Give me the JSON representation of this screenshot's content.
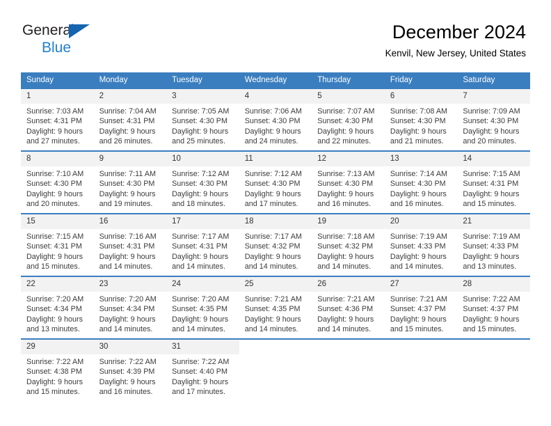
{
  "brand": {
    "line1": "General",
    "line2": "Blue",
    "triangle_color": "#1565b0",
    "line2_color": "#1f7fd4"
  },
  "header": {
    "title": "December 2024",
    "subtitle": "Kenvil, New Jersey, United States"
  },
  "theme": {
    "header_row_bg": "#3a7ebf",
    "header_row_text": "#ffffff",
    "daynum_bg": "#f2f2f2",
    "row_border": "#3a7ebf",
    "body_text": "#3b3b3b"
  },
  "weekday_headers": [
    "Sunday",
    "Monday",
    "Tuesday",
    "Wednesday",
    "Thursday",
    "Friday",
    "Saturday"
  ],
  "weeks": [
    [
      {
        "day": "1",
        "sunrise": "Sunrise: 7:03 AM",
        "sunset": "Sunset: 4:31 PM",
        "daylight1": "Daylight: 9 hours",
        "daylight2": "and 27 minutes."
      },
      {
        "day": "2",
        "sunrise": "Sunrise: 7:04 AM",
        "sunset": "Sunset: 4:31 PM",
        "daylight1": "Daylight: 9 hours",
        "daylight2": "and 26 minutes."
      },
      {
        "day": "3",
        "sunrise": "Sunrise: 7:05 AM",
        "sunset": "Sunset: 4:30 PM",
        "daylight1": "Daylight: 9 hours",
        "daylight2": "and 25 minutes."
      },
      {
        "day": "4",
        "sunrise": "Sunrise: 7:06 AM",
        "sunset": "Sunset: 4:30 PM",
        "daylight1": "Daylight: 9 hours",
        "daylight2": "and 24 minutes."
      },
      {
        "day": "5",
        "sunrise": "Sunrise: 7:07 AM",
        "sunset": "Sunset: 4:30 PM",
        "daylight1": "Daylight: 9 hours",
        "daylight2": "and 22 minutes."
      },
      {
        "day": "6",
        "sunrise": "Sunrise: 7:08 AM",
        "sunset": "Sunset: 4:30 PM",
        "daylight1": "Daylight: 9 hours",
        "daylight2": "and 21 minutes."
      },
      {
        "day": "7",
        "sunrise": "Sunrise: 7:09 AM",
        "sunset": "Sunset: 4:30 PM",
        "daylight1": "Daylight: 9 hours",
        "daylight2": "and 20 minutes."
      }
    ],
    [
      {
        "day": "8",
        "sunrise": "Sunrise: 7:10 AM",
        "sunset": "Sunset: 4:30 PM",
        "daylight1": "Daylight: 9 hours",
        "daylight2": "and 20 minutes."
      },
      {
        "day": "9",
        "sunrise": "Sunrise: 7:11 AM",
        "sunset": "Sunset: 4:30 PM",
        "daylight1": "Daylight: 9 hours",
        "daylight2": "and 19 minutes."
      },
      {
        "day": "10",
        "sunrise": "Sunrise: 7:12 AM",
        "sunset": "Sunset: 4:30 PM",
        "daylight1": "Daylight: 9 hours",
        "daylight2": "and 18 minutes."
      },
      {
        "day": "11",
        "sunrise": "Sunrise: 7:12 AM",
        "sunset": "Sunset: 4:30 PM",
        "daylight1": "Daylight: 9 hours",
        "daylight2": "and 17 minutes."
      },
      {
        "day": "12",
        "sunrise": "Sunrise: 7:13 AM",
        "sunset": "Sunset: 4:30 PM",
        "daylight1": "Daylight: 9 hours",
        "daylight2": "and 16 minutes."
      },
      {
        "day": "13",
        "sunrise": "Sunrise: 7:14 AM",
        "sunset": "Sunset: 4:30 PM",
        "daylight1": "Daylight: 9 hours",
        "daylight2": "and 16 minutes."
      },
      {
        "day": "14",
        "sunrise": "Sunrise: 7:15 AM",
        "sunset": "Sunset: 4:31 PM",
        "daylight1": "Daylight: 9 hours",
        "daylight2": "and 15 minutes."
      }
    ],
    [
      {
        "day": "15",
        "sunrise": "Sunrise: 7:15 AM",
        "sunset": "Sunset: 4:31 PM",
        "daylight1": "Daylight: 9 hours",
        "daylight2": "and 15 minutes."
      },
      {
        "day": "16",
        "sunrise": "Sunrise: 7:16 AM",
        "sunset": "Sunset: 4:31 PM",
        "daylight1": "Daylight: 9 hours",
        "daylight2": "and 14 minutes."
      },
      {
        "day": "17",
        "sunrise": "Sunrise: 7:17 AM",
        "sunset": "Sunset: 4:31 PM",
        "daylight1": "Daylight: 9 hours",
        "daylight2": "and 14 minutes."
      },
      {
        "day": "18",
        "sunrise": "Sunrise: 7:17 AM",
        "sunset": "Sunset: 4:32 PM",
        "daylight1": "Daylight: 9 hours",
        "daylight2": "and 14 minutes."
      },
      {
        "day": "19",
        "sunrise": "Sunrise: 7:18 AM",
        "sunset": "Sunset: 4:32 PM",
        "daylight1": "Daylight: 9 hours",
        "daylight2": "and 14 minutes."
      },
      {
        "day": "20",
        "sunrise": "Sunrise: 7:19 AM",
        "sunset": "Sunset: 4:33 PM",
        "daylight1": "Daylight: 9 hours",
        "daylight2": "and 14 minutes."
      },
      {
        "day": "21",
        "sunrise": "Sunrise: 7:19 AM",
        "sunset": "Sunset: 4:33 PM",
        "daylight1": "Daylight: 9 hours",
        "daylight2": "and 13 minutes."
      }
    ],
    [
      {
        "day": "22",
        "sunrise": "Sunrise: 7:20 AM",
        "sunset": "Sunset: 4:34 PM",
        "daylight1": "Daylight: 9 hours",
        "daylight2": "and 13 minutes."
      },
      {
        "day": "23",
        "sunrise": "Sunrise: 7:20 AM",
        "sunset": "Sunset: 4:34 PM",
        "daylight1": "Daylight: 9 hours",
        "daylight2": "and 14 minutes."
      },
      {
        "day": "24",
        "sunrise": "Sunrise: 7:20 AM",
        "sunset": "Sunset: 4:35 PM",
        "daylight1": "Daylight: 9 hours",
        "daylight2": "and 14 minutes."
      },
      {
        "day": "25",
        "sunrise": "Sunrise: 7:21 AM",
        "sunset": "Sunset: 4:35 PM",
        "daylight1": "Daylight: 9 hours",
        "daylight2": "and 14 minutes."
      },
      {
        "day": "26",
        "sunrise": "Sunrise: 7:21 AM",
        "sunset": "Sunset: 4:36 PM",
        "daylight1": "Daylight: 9 hours",
        "daylight2": "and 14 minutes."
      },
      {
        "day": "27",
        "sunrise": "Sunrise: 7:21 AM",
        "sunset": "Sunset: 4:37 PM",
        "daylight1": "Daylight: 9 hours",
        "daylight2": "and 15 minutes."
      },
      {
        "day": "28",
        "sunrise": "Sunrise: 7:22 AM",
        "sunset": "Sunset: 4:37 PM",
        "daylight1": "Daylight: 9 hours",
        "daylight2": "and 15 minutes."
      }
    ],
    [
      {
        "day": "29",
        "sunrise": "Sunrise: 7:22 AM",
        "sunset": "Sunset: 4:38 PM",
        "daylight1": "Daylight: 9 hours",
        "daylight2": "and 15 minutes."
      },
      {
        "day": "30",
        "sunrise": "Sunrise: 7:22 AM",
        "sunset": "Sunset: 4:39 PM",
        "daylight1": "Daylight: 9 hours",
        "daylight2": "and 16 minutes."
      },
      {
        "day": "31",
        "sunrise": "Sunrise: 7:22 AM",
        "sunset": "Sunset: 4:40 PM",
        "daylight1": "Daylight: 9 hours",
        "daylight2": "and 17 minutes."
      },
      {
        "day": "",
        "sunrise": "",
        "sunset": "",
        "daylight1": "",
        "daylight2": ""
      },
      {
        "day": "",
        "sunrise": "",
        "sunset": "",
        "daylight1": "",
        "daylight2": ""
      },
      {
        "day": "",
        "sunrise": "",
        "sunset": "",
        "daylight1": "",
        "daylight2": ""
      },
      {
        "day": "",
        "sunrise": "",
        "sunset": "",
        "daylight1": "",
        "daylight2": ""
      }
    ]
  ]
}
